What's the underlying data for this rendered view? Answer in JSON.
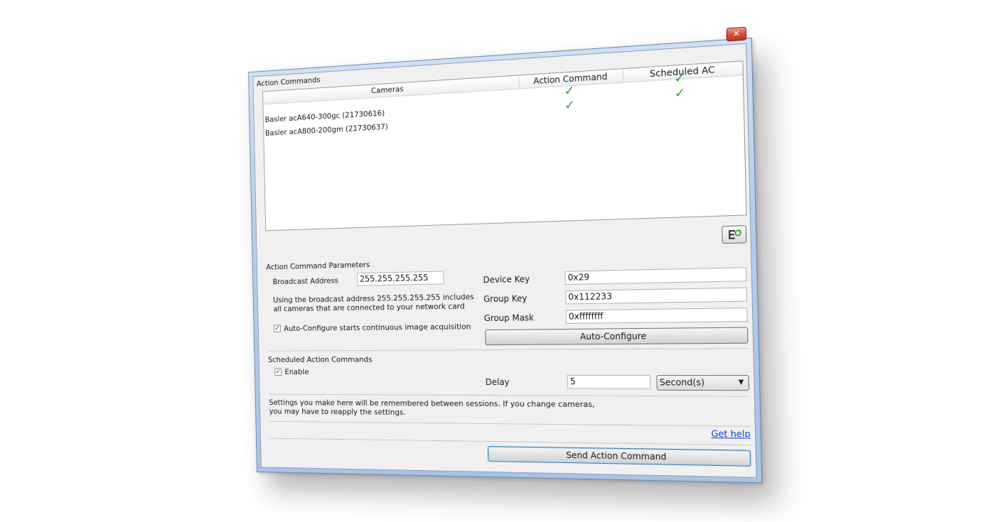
{
  "window": {
    "title": "Action Commands",
    "close_glyph": "✕"
  },
  "grid": {
    "headers": {
      "cameras": "Cameras",
      "action_command": "Action Command",
      "scheduled_ac": "Scheduled AC"
    },
    "rows": [
      {
        "camera": "Basler acA640-300gc (21730616)",
        "action_command": "✓",
        "scheduled_ac": "✓"
      },
      {
        "camera": "Basler acA800-200gm (21730637)",
        "action_command": "✓",
        "scheduled_ac": "✓"
      }
    ]
  },
  "refresh_icon": "refresh-list-icon",
  "params": {
    "section_label": "Action Command Parameters",
    "broadcast_label": "Broadcast Address",
    "broadcast_value": "255.255.255.255",
    "broadcast_note_line1": "Using the broadcast address 255.255.255.255 includes",
    "broadcast_note_line2": "all cameras that are connected to your network card",
    "autoconfig_check_label": "Auto-Configure starts continuous image acquisition",
    "autoconfig_checked": true,
    "device_key_label": "Device Key",
    "device_key_value": "0x29",
    "group_key_label": "Group Key",
    "group_key_value": "0x112233",
    "group_mask_label": "Group Mask",
    "group_mask_value": "0xffffffff",
    "autoconfig_button": "Auto-Configure"
  },
  "scheduled": {
    "section_label": "Scheduled Action Commands",
    "enable_label": "Enable",
    "enable_checked": true,
    "delay_label": "Delay",
    "delay_value": "5",
    "unit_value": "Second(s)"
  },
  "footer": {
    "note_line1": "Settings you make here will be remembered between sessions. If you change cameras,",
    "note_line2": "you may have to reapply the settings.",
    "help_link": "Get help",
    "send_button": "Send Action Command"
  },
  "colors": {
    "check": "#1f9a2f",
    "link": "#0a3fd1",
    "accent_border": "#3c7fb1"
  }
}
